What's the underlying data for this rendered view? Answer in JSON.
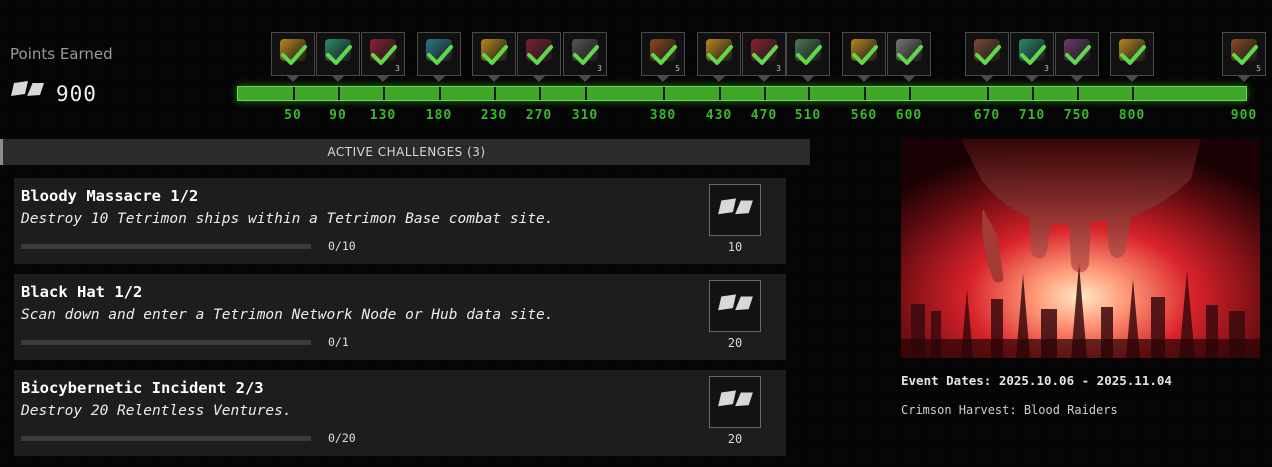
{
  "header": {
    "points_label": "Points Earned",
    "points_value": "900",
    "points_icon": "flag-icon"
  },
  "milestones": [
    "50",
    "90",
    "130",
    "180",
    "230",
    "270",
    "310",
    "380",
    "430",
    "470",
    "510",
    "560",
    "600",
    "670",
    "710",
    "750",
    "800",
    "900"
  ],
  "rewards": [
    {
      "label": "50",
      "color": "#b8871f",
      "qty": ""
    },
    {
      "label": "90",
      "color": "#2b8a70",
      "qty": ""
    },
    {
      "label": "130",
      "color": "#8b2233",
      "qty": "3"
    },
    {
      "label": "180",
      "color": "#2a7a88",
      "qty": ""
    },
    {
      "label": "230",
      "color": "#b8871f",
      "qty": ""
    },
    {
      "label": "270",
      "color": "#7a2233",
      "qty": ""
    },
    {
      "label": "310",
      "color": "#555555",
      "qty": "3"
    },
    {
      "label": "380",
      "color": "#8a4a22",
      "qty": "5"
    },
    {
      "label": "430",
      "color": "#b8871f",
      "qty": ""
    },
    {
      "label": "470",
      "color": "#8b2233",
      "qty": "3"
    },
    {
      "label": "510",
      "color": "#4a7a55",
      "qty": ""
    },
    {
      "label": "560",
      "color": "#b8871f",
      "qty": ""
    },
    {
      "label": "600",
      "color": "#777777",
      "qty": ""
    },
    {
      "label": "670",
      "color": "#7a4a33",
      "qty": ""
    },
    {
      "label": "710",
      "color": "#2b8a70",
      "qty": "3"
    },
    {
      "label": "750",
      "color": "#6a3a6a",
      "qty": ""
    },
    {
      "label": "800",
      "color": "#b8871f",
      "qty": ""
    },
    {
      "label": "900",
      "color": "#8a4a22",
      "qty": "5"
    }
  ],
  "challenges_header": "ACTIVE CHALLENGES (3)",
  "challenges": [
    {
      "title": "Bloody Massacre 1/2",
      "description": "Destroy 10 Tetrimon ships within a Tetrimon Base combat site.",
      "progress": "0/10",
      "progress_fraction": 0,
      "reward": "10"
    },
    {
      "title": "Black Hat 1/2",
      "description": "Scan down and enter a Tetrimon Network Node or Hub data site.",
      "progress": "0/1",
      "progress_fraction": 0,
      "reward": "20"
    },
    {
      "title": "Biocybernetic Incident 2/3",
      "description": "Destroy 20 Relentless Ventures.",
      "progress": "0/20",
      "progress_fraction": 0,
      "reward": "20"
    }
  ],
  "event": {
    "dates": "Event Dates: 2025.10.06 - 2025.11.04",
    "name": "Crimson Harvest: Blood Raiders"
  },
  "colors": {
    "track_green": "#3fa82a",
    "milestone_text": "#37b92a",
    "check_green": "#5fd84a"
  }
}
